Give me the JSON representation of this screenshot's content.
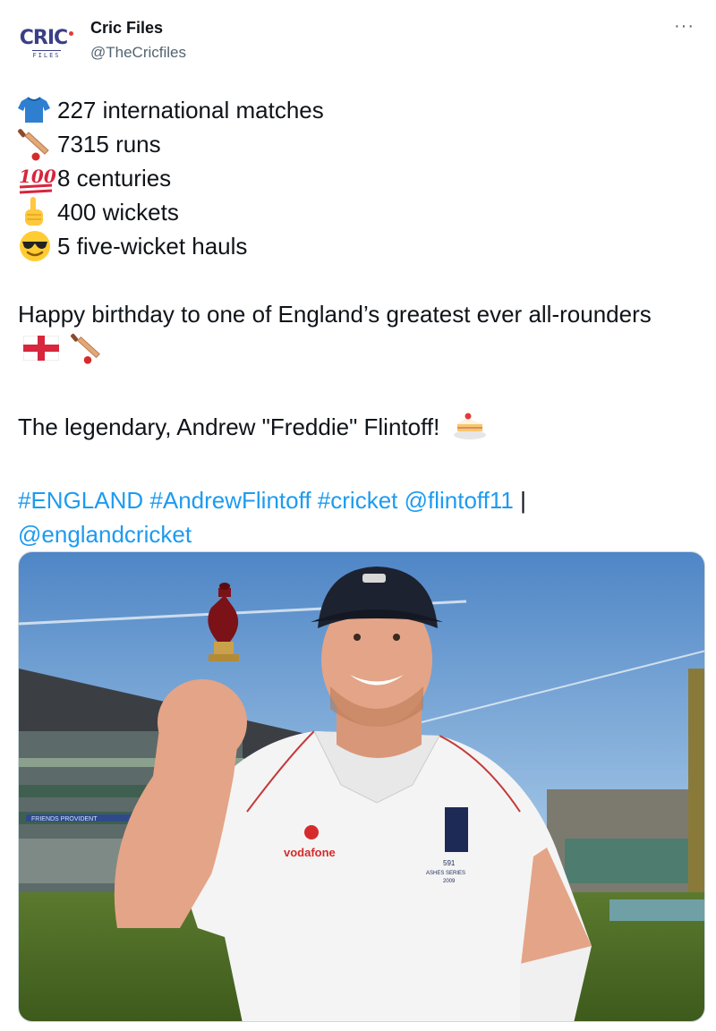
{
  "author": {
    "display_name": "Cric Files",
    "handle": "@TheCricfiles",
    "avatar_logo_main": "CRIC",
    "avatar_logo_sub": "FILES"
  },
  "menu": {
    "more_label": "···"
  },
  "stats": [
    {
      "icon": "cricket-shirt-icon",
      "text": "227 international matches"
    },
    {
      "icon": "cricket-bat-ball-icon",
      "text": "7315 runs"
    },
    {
      "icon": "hundred-points-icon",
      "text": "8 centuries"
    },
    {
      "icon": "index-pointing-up-icon",
      "text": "400 wickets"
    },
    {
      "icon": "sunglasses-face-icon",
      "text": "5 five-wicket hauls"
    }
  ],
  "hundred_glyph": "100",
  "birthday_text": "Happy birthday to one of England’s greatest ever all-rounders",
  "legend_text": "The legendary, Andrew \"Freddie\" Flintoff!",
  "tags": {
    "england": "#ENGLAND",
    "flintoff": "#AndrewFlintoff",
    "cricket": "#cricket",
    "mention1": "@flintoff11",
    "separator": "|",
    "mention2": "@englandcricket"
  },
  "media": {
    "shirt_sponsor": "vodafone",
    "shirt_text_line1": "591",
    "shirt_text_line2": "ASHES SERIES",
    "shirt_text_line3": "2009",
    "stand_banner": "FRIENDS PROVIDENT"
  },
  "colors": {
    "link": "#1d9bf0",
    "text": "#0f1419",
    "secondary": "#536471"
  }
}
